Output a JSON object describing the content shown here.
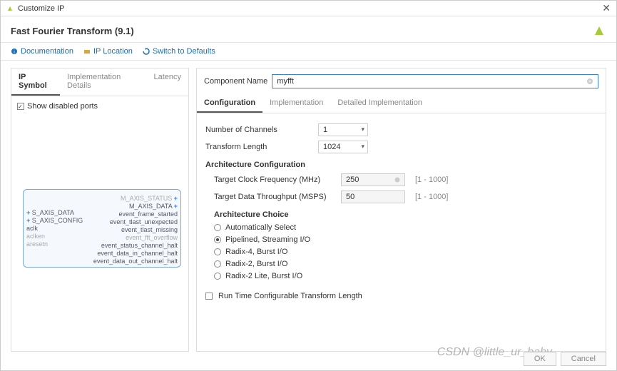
{
  "window": {
    "title": "Customize IP"
  },
  "header": {
    "title": "Fast Fourier Transform (9.1)"
  },
  "toolbar": {
    "documentation": "Documentation",
    "ip_location": "IP Location",
    "switch_defaults": "Switch to Defaults"
  },
  "left": {
    "tabs": {
      "symbol": "IP Symbol",
      "impl": "Implementation Details",
      "latency": "Latency"
    },
    "show_disabled": "Show disabled ports",
    "block": {
      "left_ports": [
        {
          "text": "S_AXIS_DATA",
          "plus": true
        },
        {
          "text": "S_AXIS_CONFIG",
          "plus": true
        },
        {
          "text": "aclk",
          "plus": false
        },
        {
          "text": "aclken",
          "dim": true
        },
        {
          "text": "aresetn",
          "dim": true
        }
      ],
      "right_ports": [
        {
          "text": "M_AXIS_STATUS",
          "dim": true,
          "plus": true
        },
        {
          "text": "M_AXIS_DATA",
          "plus": true
        },
        {
          "text": "event_frame_started"
        },
        {
          "text": "event_tlast_unexpected"
        },
        {
          "text": "event_tlast_missing"
        },
        {
          "text": "event_fft_overflow",
          "dim": true
        },
        {
          "text": "event_status_channel_halt"
        },
        {
          "text": "event_data_in_channel_halt"
        },
        {
          "text": "event_data_out_channel_halt"
        }
      ]
    }
  },
  "right": {
    "component_label": "Component Name",
    "component_value": "myfft",
    "tabs": {
      "config": "Configuration",
      "impl": "Implementation",
      "detail": "Detailed Implementation"
    },
    "num_channels_label": "Number of Channels",
    "num_channels_value": "1",
    "transform_length_label": "Transform Length",
    "transform_length_value": "1024",
    "arch_config_title": "Architecture Configuration",
    "clock_freq_label": "Target Clock Frequency (MHz)",
    "clock_freq_value": "250",
    "clock_freq_hint": "[1 - 1000]",
    "throughput_label": "Target Data Throughput (MSPS)",
    "throughput_value": "50",
    "throughput_hint": "[1 - 1000]",
    "arch_choice_title": "Architecture Choice",
    "arch_choices": [
      "Automatically Select",
      "Pipelined, Streaming I/O",
      "Radix-4, Burst I/O",
      "Radix-2, Burst I/O",
      "Radix-2 Lite, Burst I/O"
    ],
    "arch_selected": 1,
    "runtime_config": "Run Time Configurable Transform Length"
  },
  "footer": {
    "ok": "OK",
    "cancel": "Cancel"
  },
  "watermark": "CSDN @little_ur_baby"
}
